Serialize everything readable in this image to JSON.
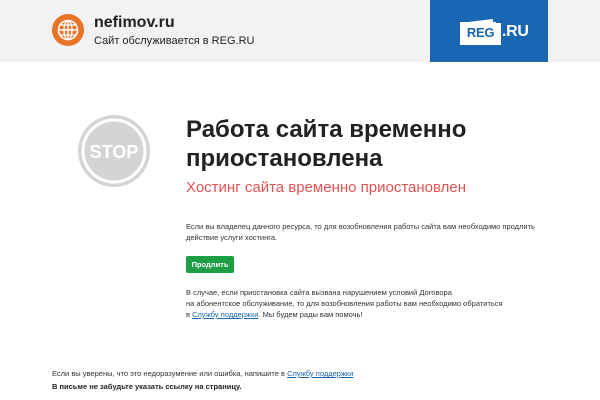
{
  "header": {
    "site_name": "nefimov.ru",
    "site_subtitle": "Сайт обслуживается в REG.RU",
    "logo_box_text": "REG",
    "logo_suffix": ".RU",
    "globe_color": "#e8742a",
    "logo_bg_color": "#1a66b3"
  },
  "main": {
    "stop_icon_text": "STOP",
    "title": "Работа сайта временно приостановлена",
    "subtitle": "Хостинг сайта временно приостановлен",
    "paragraph1": "Если вы владелец данного ресурса, то для возобновления работы сайта вам необходимо продлить действие услуги хостинга.",
    "extend_button": "Продлить",
    "paragraph2_line1": "В случае, если приостановка сайта вызвана нарушением условий Договора",
    "paragraph2_line2": "на абонентское обслуживание, то для возобновления работы вам необходимо обратиться",
    "paragraph2_line3_prefix": "в ",
    "support_link": "Службу поддержки",
    "paragraph2_line3_suffix": ". Мы будем рады вам помочь!",
    "accent_color": "#e05353",
    "button_color": "#1e9e45"
  },
  "footer": {
    "line1_prefix": "Если вы уверены, что это недоразумение или ошибка, напишите в ",
    "support_link": "Службу поддержки",
    "line2": "В письме не забудьте указать ссылку на страницу."
  }
}
